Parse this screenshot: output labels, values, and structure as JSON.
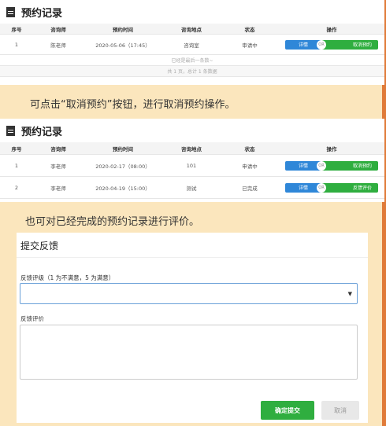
{
  "section1": {
    "title": "预约记录",
    "columns": [
      "序号",
      "咨询师",
      "预约时间",
      "咨询地点",
      "状态",
      "操作"
    ],
    "rows": [
      {
        "no": "1",
        "counselor": "陈老师",
        "time": "2020-05-06（17:45）",
        "place": "咨询室",
        "status": "审请中",
        "detail": "详情",
        "or": "OR",
        "action": "取消预约"
      }
    ],
    "footer_end": "已经是最后一条数~",
    "footer_pages": "共 1 页，总计 1 条数据"
  },
  "caption1": "可点击“取消预约”按钮，进行取消预约操作。",
  "section2": {
    "title": "预约记录",
    "columns": [
      "序号",
      "咨询师",
      "预约时间",
      "咨询地点",
      "状态",
      "操作"
    ],
    "rows": [
      {
        "no": "1",
        "counselor": "李老师",
        "time": "2020-02-17（08:00）",
        "place": "101",
        "status": "申请中",
        "detail": "详情",
        "or": "OR",
        "action": "取消预约"
      },
      {
        "no": "2",
        "counselor": "李老师",
        "time": "2020-04-19（15:00）",
        "place": "测试",
        "status": "已完成",
        "detail": "详情",
        "or": "OR",
        "action": "反馈评价"
      }
    ]
  },
  "caption2": "也可对已经完成的预约记录进行评价。",
  "feedback": {
    "title": "提交反馈",
    "rating_label": "反馈评级（1 为不满意，5 为满意）",
    "rating_value": "",
    "comment_label": "反馈评价",
    "comment_value": "",
    "submit_label": "确定提交",
    "cancel_label": "取消"
  },
  "colors": {
    "background": "#fbe6bd",
    "primary": "#2f87d8",
    "success": "#2fae3f",
    "rail": "#e07b39"
  }
}
